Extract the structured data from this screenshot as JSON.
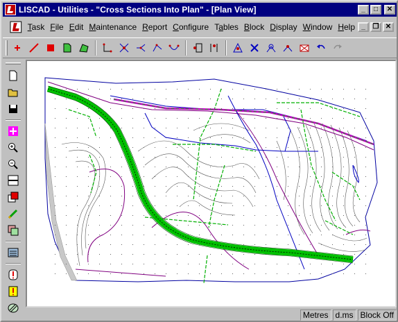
{
  "window": {
    "title": "LISCAD - Utilities - \"Cross Sections Into Plan\" - [Plan View]",
    "controls": {
      "minimize": "_",
      "maximize": "□",
      "close": "✕"
    }
  },
  "menu": {
    "items": [
      {
        "pre": "",
        "ul": "T",
        "post": "ask"
      },
      {
        "pre": "",
        "ul": "F",
        "post": "ile"
      },
      {
        "pre": "",
        "ul": "E",
        "post": "dit"
      },
      {
        "pre": "",
        "ul": "M",
        "post": "aintenance"
      },
      {
        "pre": "",
        "ul": "R",
        "post": "eport"
      },
      {
        "pre": "",
        "ul": "C",
        "post": "onfigure"
      },
      {
        "pre": "T",
        "ul": "a",
        "post": "bles"
      },
      {
        "pre": "",
        "ul": "B",
        "post": "lock"
      },
      {
        "pre": "",
        "ul": "D",
        "post": "isplay"
      },
      {
        "pre": "",
        "ul": "W",
        "post": "indow"
      },
      {
        "pre": "",
        "ul": "H",
        "post": "elp"
      }
    ],
    "mdi": {
      "minimize": "_",
      "restore": "❐",
      "close": "✕"
    }
  },
  "toolbar": {
    "icons": [
      "point-icon",
      "line-icon",
      "square-icon",
      "document-green-icon",
      "polygon-icon",
      "rectangle-select-icon",
      "intersect-icon",
      "branch-icon",
      "polyline-icon",
      "arc-icon",
      "insert-point-icon",
      "insert-vertex-icon",
      "survey-icon",
      "delete-point-icon",
      "move-point-icon",
      "edit-node-icon",
      "close-envelope-icon",
      "undo-icon",
      "redo-icon"
    ]
  },
  "sidebar": {
    "icons": [
      "new-file-icon",
      "open-folder-icon",
      "save-icon",
      "pan-icon",
      "zoom-in-icon",
      "zoom-out-icon",
      "zoom-window-icon",
      "layer-icon",
      "pencil-icon",
      "copy-icon",
      "calculator-icon",
      "warning-red-icon",
      "warning-yellow-icon",
      "hatch-icon"
    ]
  },
  "status": {
    "units": "Metres",
    "angle": "d.ms",
    "block": "Block Off"
  },
  "colors": {
    "titlebar": "#000080",
    "contour": "#4a4a4a",
    "road": "#00c000",
    "boundary": "#800080",
    "drainage": "#0000c0"
  }
}
